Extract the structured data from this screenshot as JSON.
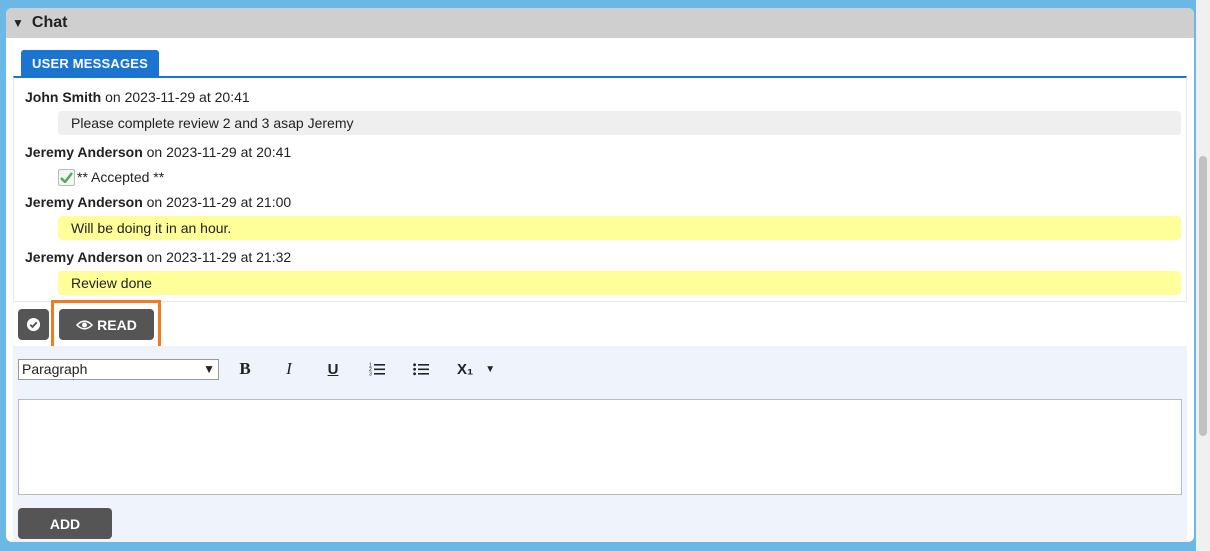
{
  "panel": {
    "title": "Chat",
    "collapse_icon": "triangle-down-icon"
  },
  "tabs": [
    {
      "label": "USER MESSAGES",
      "active": true
    }
  ],
  "messages": [
    {
      "author": "John Smith",
      "meta": " on 2023-11-29 at 20:41",
      "text": "Please complete review 2 and 3 asap Jeremy",
      "style": "gray"
    },
    {
      "author": "Jeremy Anderson",
      "meta": " on 2023-11-29 at 20:41",
      "text": "** Accepted **",
      "style": "accept"
    },
    {
      "author": "Jeremy Anderson",
      "meta": " on 2023-11-29 at 21:00",
      "text": "Will be doing it in an hour.",
      "style": "yellow"
    },
    {
      "author": "Jeremy Anderson",
      "meta": " on 2023-11-29 at 21:32",
      "text": "Review done",
      "style": "yellow"
    }
  ],
  "actions": {
    "read_label": "READ",
    "read_icon": "eye-icon",
    "check_icon": "check-circle-icon"
  },
  "editor": {
    "format_select": "Paragraph",
    "toolbar": {
      "bold": "B",
      "italic": "I",
      "underline": "U",
      "subscript": "X₁"
    },
    "add_label": "ADD"
  },
  "colors": {
    "tab_blue": "#1b75d0",
    "highlight_orange": "#f07b23",
    "frame_blue": "#6bb8e6",
    "yellow_bubble": "#ffff99"
  }
}
